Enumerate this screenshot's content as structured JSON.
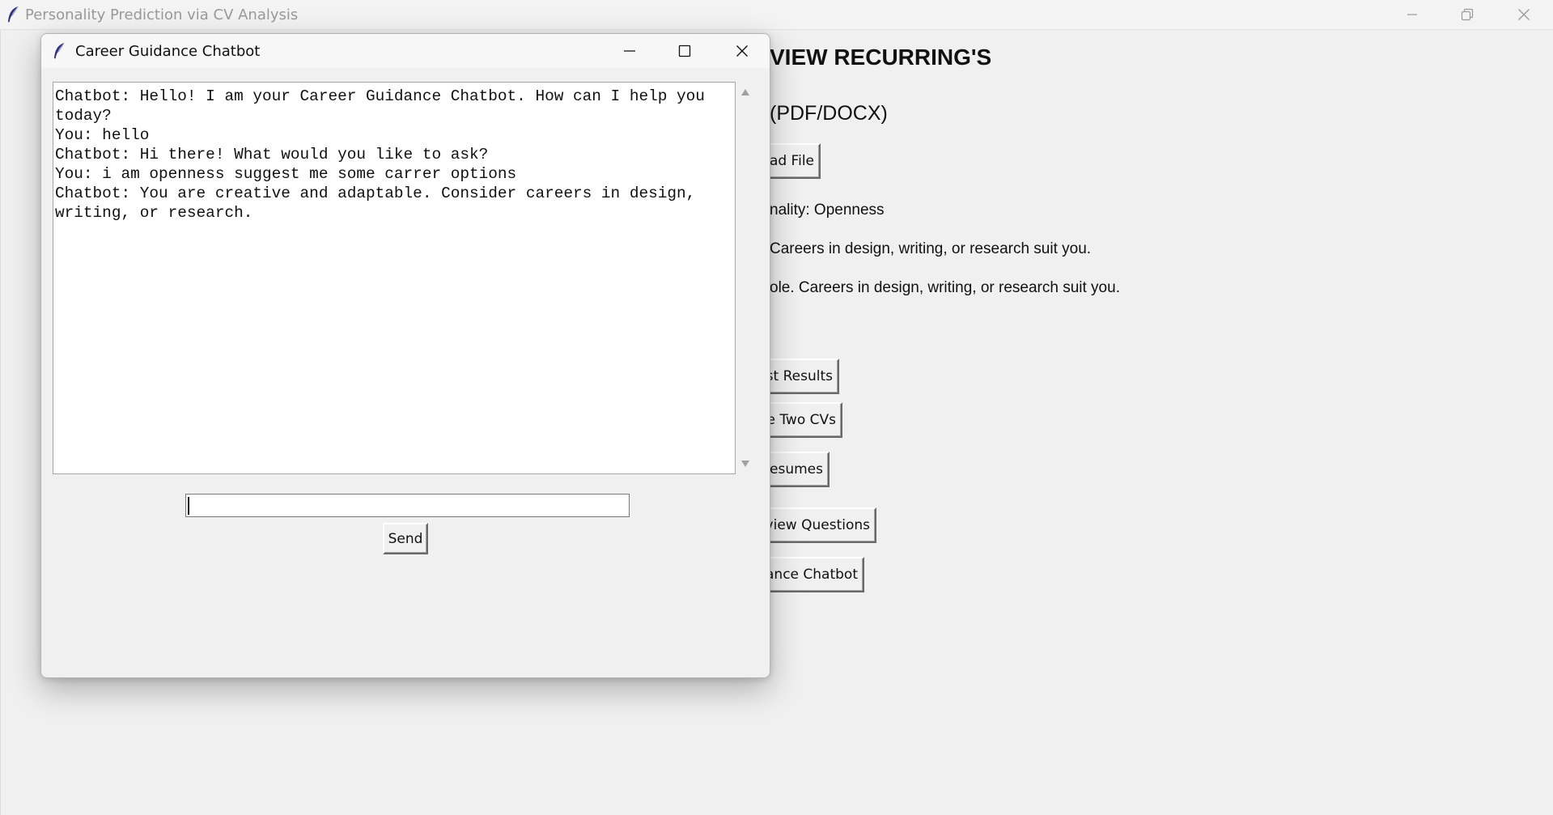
{
  "main_window": {
    "title": "Personality Prediction via CV Analysis",
    "heading": "VIEW RECURRING'S",
    "subheading": "(PDF/DOCX)",
    "upload_button": "ad File",
    "personality_label": "nality: Openness",
    "career_label": "Careers in design, writing, or research suit you.",
    "summary_label": "ole. Careers in design, writing, or research suit you.",
    "buttons": {
      "past_results": "ast Results",
      "compare_cvs": "e Two CVs",
      "resumes": "Resumes",
      "interview_questions": "rview Questions",
      "guidance_chatbot": "ance Chatbot"
    }
  },
  "chatbot_dialog": {
    "title": "Career Guidance Chatbot",
    "messages": [
      "Chatbot: Hello! I am your Career Guidance Chatbot. How can I help you today?",
      "You: hello",
      "Chatbot: Hi there! What would you like to ask?",
      "You: i am openness suggest me some carrer options",
      "Chatbot: You are creative and adaptable. Consider careers in design, writing, or research."
    ],
    "input_value": "",
    "send_label": "Send"
  },
  "icons": {
    "app": "feather-icon",
    "minimize": "minimize-icon",
    "restore": "restore-icon",
    "maximize": "maximize-icon",
    "close": "close-icon",
    "scroll_up": "scroll-up-arrow-icon",
    "scroll_down": "scroll-down-arrow-icon"
  },
  "colors": {
    "background": "#f0f0f0",
    "text": "#111111",
    "title_inactive": "#9a9a9a"
  }
}
